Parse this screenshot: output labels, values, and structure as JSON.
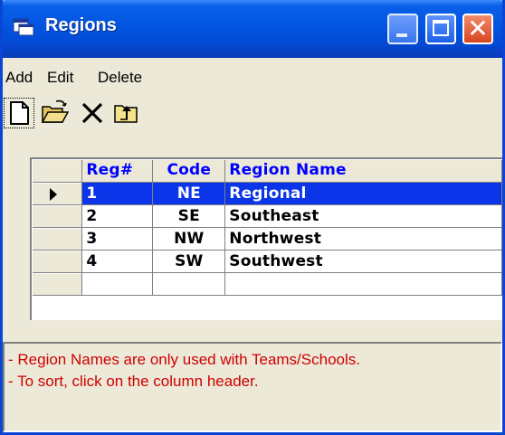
{
  "window": {
    "title": "Regions"
  },
  "menu": {
    "items": [
      "Add",
      "Edit",
      "Delete"
    ]
  },
  "toolbar": {
    "icons": [
      "new-icon",
      "open-folder-icon",
      "delete-x-icon",
      "up-folder-icon"
    ]
  },
  "grid": {
    "columns": [
      "Reg#",
      "Code",
      "Region Name"
    ],
    "rows": [
      {
        "reg": "1",
        "code": "NE",
        "name": "Regional",
        "selected": true
      },
      {
        "reg": "2",
        "code": "SE",
        "name": "Southeast",
        "selected": false
      },
      {
        "reg": "3",
        "code": "NW",
        "name": "Northwest",
        "selected": false
      },
      {
        "reg": "4",
        "code": "SW",
        "name": "Southwest",
        "selected": false
      }
    ]
  },
  "info": {
    "lines": [
      "- Region Names are only used with Teams/Schools.",
      "- To sort, click on the column header."
    ]
  },
  "colors": {
    "title_bar": "#0255e0",
    "selection": "#0a35e8",
    "header_text": "#0000ff",
    "info_text": "#d00000"
  }
}
